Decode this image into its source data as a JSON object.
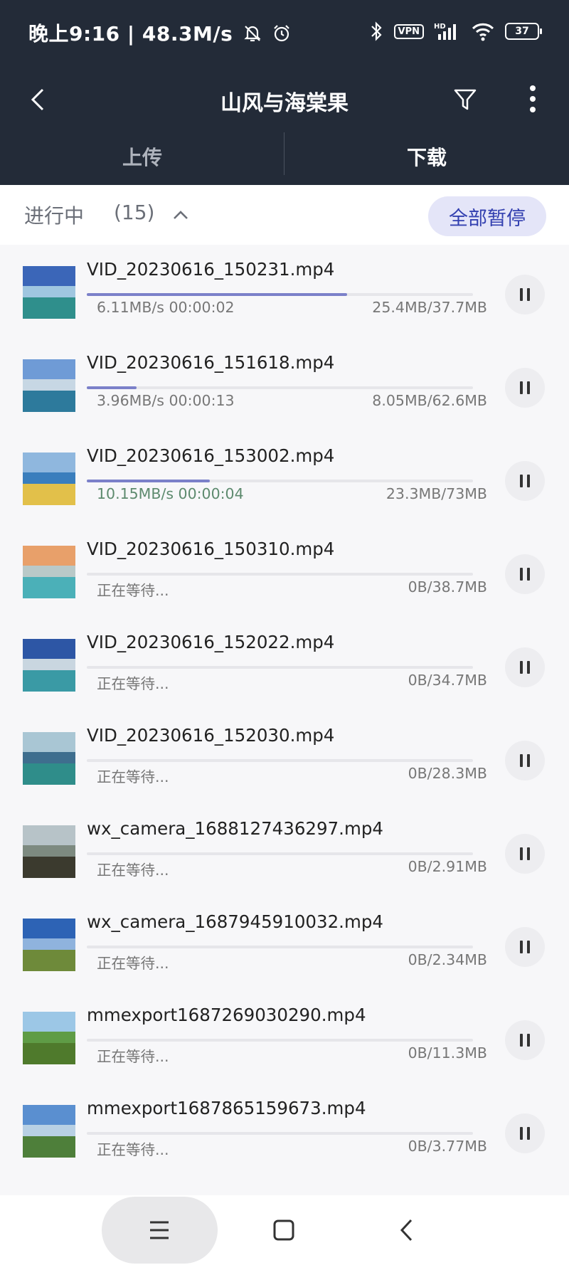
{
  "status_bar": {
    "time": "晚上9:16",
    "speed": "48.3M/s",
    "vpn": "VPN",
    "network": "HD",
    "battery": "37"
  },
  "header": {
    "title": "山风与海棠果"
  },
  "tabs": [
    {
      "label": "上传"
    },
    {
      "label": "下载"
    }
  ],
  "section": {
    "title": "进行中",
    "count": "(15)",
    "pause_all_label": "全部暂停"
  },
  "items": [
    {
      "name": "VID_20230616_150231.mp4",
      "status": "6.11MB/s 00:00:02",
      "size": "25.4MB/37.7MB",
      "progress": 0.674,
      "thumb": [
        "#3b66b8",
        "#9fc6e0",
        "#2f8f8c"
      ]
    },
    {
      "name": "VID_20230616_151618.mp4",
      "status": "3.96MB/s 00:00:13",
      "size": "8.05MB/62.6MB",
      "progress": 0.129,
      "thumb": [
        "#6f9bd6",
        "#c7d7e4",
        "#2d7a9c"
      ]
    },
    {
      "name": "VID_20230616_153002.mp4",
      "status": "10.15MB/s 00:00:04",
      "size": "23.3MB/73MB",
      "progress": 0.319,
      "thumb": [
        "#8fb7de",
        "#3a7ebd",
        "#e2c04a"
      ]
    },
    {
      "name": "VID_20230616_150310.mp4",
      "status": "正在等待...",
      "size": "0B/38.7MB",
      "progress": 0,
      "thumb": [
        "#e8a06a",
        "#b9c9c8",
        "#4bb0b8"
      ]
    },
    {
      "name": "VID_20230616_152022.mp4",
      "status": "正在等待...",
      "size": "0B/34.7MB",
      "progress": 0,
      "thumb": [
        "#2d56a5",
        "#c9d6e0",
        "#3a9aa5"
      ]
    },
    {
      "name": "VID_20230616_152030.mp4",
      "status": "正在等待...",
      "size": "0B/28.3MB",
      "progress": 0,
      "thumb": [
        "#a9c6d4",
        "#3e6e8e",
        "#2f8d8a"
      ]
    },
    {
      "name": "wx_camera_1688127436297.mp4",
      "status": "正在等待...",
      "size": "0B/2.91MB",
      "progress": 0,
      "thumb": [
        "#b7c3c8",
        "#7d8a80",
        "#3b3a2e"
      ]
    },
    {
      "name": "wx_camera_1687945910032.mp4",
      "status": "正在等待...",
      "size": "0B/2.34MB",
      "progress": 0,
      "thumb": [
        "#2d63b5",
        "#8fb3dd",
        "#6e8a3a"
      ]
    },
    {
      "name": "mmexport1687269030290.mp4",
      "status": "正在等待...",
      "size": "0B/11.3MB",
      "progress": 0,
      "thumb": [
        "#9cc7e6",
        "#5f9c46",
        "#4f7a2c"
      ]
    },
    {
      "name": "mmexport1687865159673.mp4",
      "status": "正在等待...",
      "size": "0B/3.77MB",
      "progress": 0,
      "thumb": [
        "#5a8fd0",
        "#b8d0e4",
        "#4e7f3a"
      ]
    }
  ],
  "colors": {
    "header_bg": "#232b38",
    "accent": "#3340b0",
    "progress": "#7b80c9"
  }
}
